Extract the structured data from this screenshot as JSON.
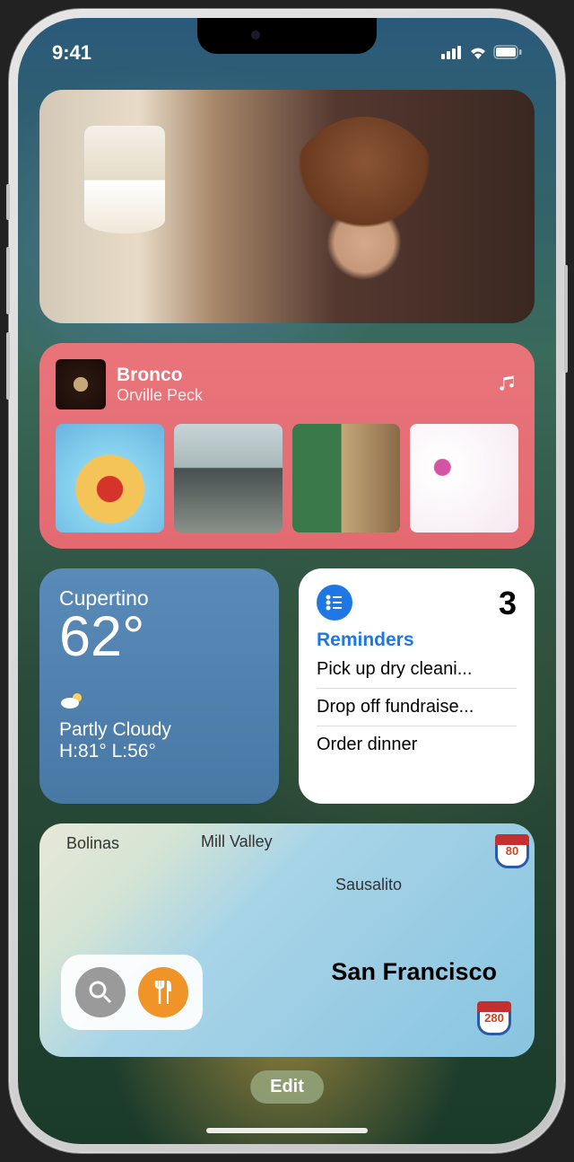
{
  "status": {
    "time": "9:41"
  },
  "music": {
    "song": "Bronco",
    "artist": "Orville Peck"
  },
  "weather": {
    "city": "Cupertino",
    "temp": "62°",
    "condition": "Partly Cloudy",
    "hilo": "H:81° L:56°"
  },
  "reminders": {
    "title": "Reminders",
    "count": "3",
    "items": [
      "Pick up dry cleani...",
      "Drop off fundraise...",
      "Order dinner"
    ]
  },
  "map": {
    "labels": {
      "bolinas": "Bolinas",
      "millvalley": "Mill Valley",
      "sausalito": "Sausalito",
      "sf": "San Francisco"
    },
    "hwy1": "80",
    "hwy2": "280"
  },
  "edit": "Edit"
}
